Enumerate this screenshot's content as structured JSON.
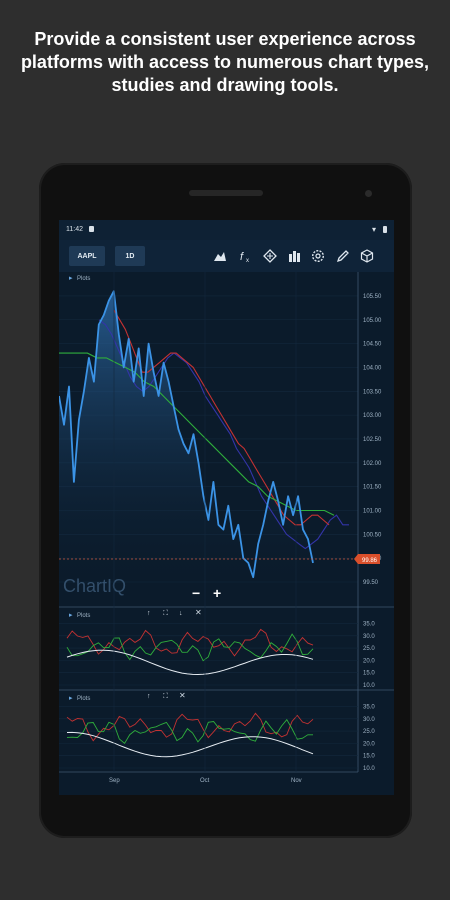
{
  "headline": "Provide a consistent user experience across platforms with access to numerous chart types, studies and drawing tools.",
  "status_bar": {
    "time": "11:42"
  },
  "toolbar": {
    "symbol": "AAPL",
    "period": "1D",
    "icons": [
      "chart-type-icon",
      "studies-icon",
      "crosshair-icon",
      "layers-icon",
      "settings-icon",
      "draw-icon",
      "cube-icon"
    ]
  },
  "chart": {
    "main_panel_label": "Plots",
    "logo": "ChartIQ",
    "zoom_out": "−",
    "zoom_in": "+",
    "y_axis_ticks": [
      "105.50",
      "105.00",
      "104.50",
      "104.00",
      "103.50",
      "103.00",
      "102.50",
      "102.00",
      "101.50",
      "101.00",
      "100.50",
      "100.00",
      "99.50"
    ],
    "current_price": "99.86",
    "x_axis_labels": [
      "Sep",
      "Oct",
      "Nov"
    ]
  },
  "study_panels": [
    {
      "label": "Plots",
      "y_axis_ticks": [
        "35.0",
        "30.0",
        "25.0",
        "20.0",
        "15.0",
        "10.0"
      ]
    },
    {
      "label": "Plots",
      "y_axis_ticks": [
        "35.0",
        "30.0",
        "25.0",
        "20.0",
        "15.0",
        "10.0"
      ]
    }
  ],
  "colors": {
    "background": "#2e2e2e",
    "screen_bg": "#0b1b2b",
    "price_line": "#3b93e6",
    "ma_blue": "#3334a8",
    "ma_red": "#c43232",
    "ma_green": "#2fae3c",
    "price_badge": "#d94f2b"
  },
  "chart_data": {
    "type": "line",
    "symbol": "AAPL",
    "x_ticks": [
      "Sep",
      "Oct",
      "Nov"
    ],
    "ylim": [
      99.5,
      105.75
    ],
    "series": [
      {
        "values": [
          103.4,
          102.8,
          103.6,
          101.6,
          102.9,
          103.5,
          104.2,
          103.7,
          104.9,
          105.1,
          105.4,
          105.6,
          104.7,
          104.0,
          104.6,
          103.7,
          104.4,
          103.4,
          104.5,
          103.9,
          103.4,
          104.1,
          103.7,
          103.2,
          102.7,
          102.4,
          102.2,
          102.6,
          102.0,
          101.3,
          100.8,
          101.6,
          100.7,
          100.6,
          101.1,
          100.4,
          100.7,
          100.0,
          99.9,
          99.6,
          100.3,
          100.7,
          101.2,
          101.6,
          101.2,
          100.7,
          101.3,
          100.9,
          101.3,
          100.6,
          100.4,
          99.9
        ]
      },
      {
        "values": [
          105.0,
          104.9,
          104.7,
          104.4,
          104.1,
          103.8,
          103.6,
          103.5,
          103.6,
          103.8,
          104.0,
          104.2,
          104.3,
          104.2,
          104.1,
          103.9,
          103.7,
          103.4,
          103.2,
          103.0,
          102.8,
          102.6,
          102.3,
          102.1,
          101.9,
          101.6,
          101.3,
          101.1,
          100.9,
          100.7,
          100.5,
          100.4,
          100.3,
          100.2,
          100.3,
          100.4,
          100.6,
          100.8,
          100.9,
          100.7,
          100.7
        ]
      },
      {
        "values": [
          105.2,
          105.0,
          104.8,
          104.5,
          104.2,
          103.9,
          103.9,
          104.0,
          104.1,
          104.2,
          104.3,
          104.3,
          104.2,
          104.1,
          104.0,
          103.8,
          103.6,
          103.4,
          103.2,
          103.0,
          102.8,
          102.6,
          102.4,
          102.3,
          102.1,
          101.9,
          101.7,
          101.5,
          101.3,
          101.1,
          100.9,
          100.8,
          100.7,
          100.7,
          100.8,
          100.9,
          100.9,
          100.8,
          100.7
        ]
      },
      {
        "values": [
          104.3,
          104.3,
          104.3,
          104.3,
          104.2,
          104.2,
          104.1,
          104.0,
          103.9,
          103.7,
          103.6,
          103.4,
          103.2,
          103.0,
          102.8,
          102.6,
          102.4,
          102.2,
          102.0,
          101.8,
          101.6,
          101.5,
          101.3,
          101.2,
          101.1,
          101.0,
          101.0,
          101.0,
          101.0,
          100.9
        ]
      }
    ]
  }
}
